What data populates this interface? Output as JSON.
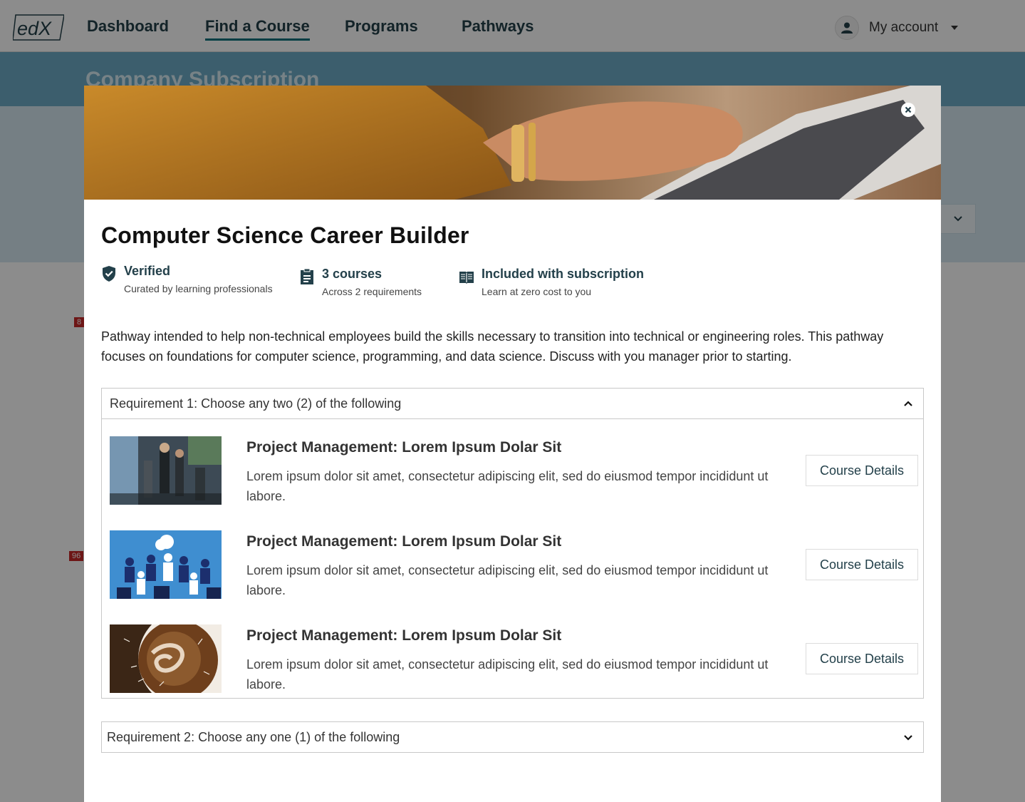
{
  "nav": {
    "logo": "edX",
    "links": [
      "Dashboard",
      "Find a Course",
      "Programs",
      "Pathways"
    ],
    "active": "Find a Course",
    "account_label": "My account"
  },
  "background": {
    "hero_title": "Company Subscription",
    "badges": [
      "8",
      "96"
    ]
  },
  "modal": {
    "title": "Computer Science Career Builder",
    "meta": [
      {
        "icon": "shield-check-icon",
        "heading": "Verified",
        "subtext": "Curated by learning professionals"
      },
      {
        "icon": "clipboard-icon",
        "heading": "3 courses",
        "subtext": "Across 2 requirements"
      },
      {
        "icon": "open-book-icon",
        "heading": "Included with subscription",
        "subtext": "Learn at zero cost to you"
      }
    ],
    "description": "Pathway intended to help non-technical employees build the skills necessary to transition into technical or engineering roles. This pathway focuses on foundations for computer science, programming, and data science. Discuss with you manager prior to starting.",
    "requirements": [
      {
        "label": "Requirement 1: Choose any two (2) of the following",
        "expanded": true,
        "courses": [
          {
            "title": "Project Management: Lorem Ipsum Dolar Sit",
            "description": "Lorem ipsum dolor sit amet, consectetur adipiscing elit, sed do eiusmod tempor incididunt ut labore.",
            "button": "Course Details"
          },
          {
            "title": "Project Management: Lorem Ipsum Dolar Sit",
            "description": "Lorem ipsum dolor sit amet, consectetur adipiscing elit, sed do eiusmod tempor incididunt ut labore.",
            "button": "Course Details"
          },
          {
            "title": "Project Management: Lorem Ipsum Dolar Sit",
            "description": "Lorem ipsum dolor sit amet, consectetur adipiscing elit, sed do eiusmod tempor incididunt ut labore.",
            "button": "Course Details"
          }
        ]
      },
      {
        "label": "Requirement 2: Choose any one (1) of the following",
        "expanded": false
      }
    ]
  },
  "colors": {
    "brand_dark": "#23404a",
    "accent_teal": "#00707a",
    "hero_blue": "#6dabc7"
  }
}
